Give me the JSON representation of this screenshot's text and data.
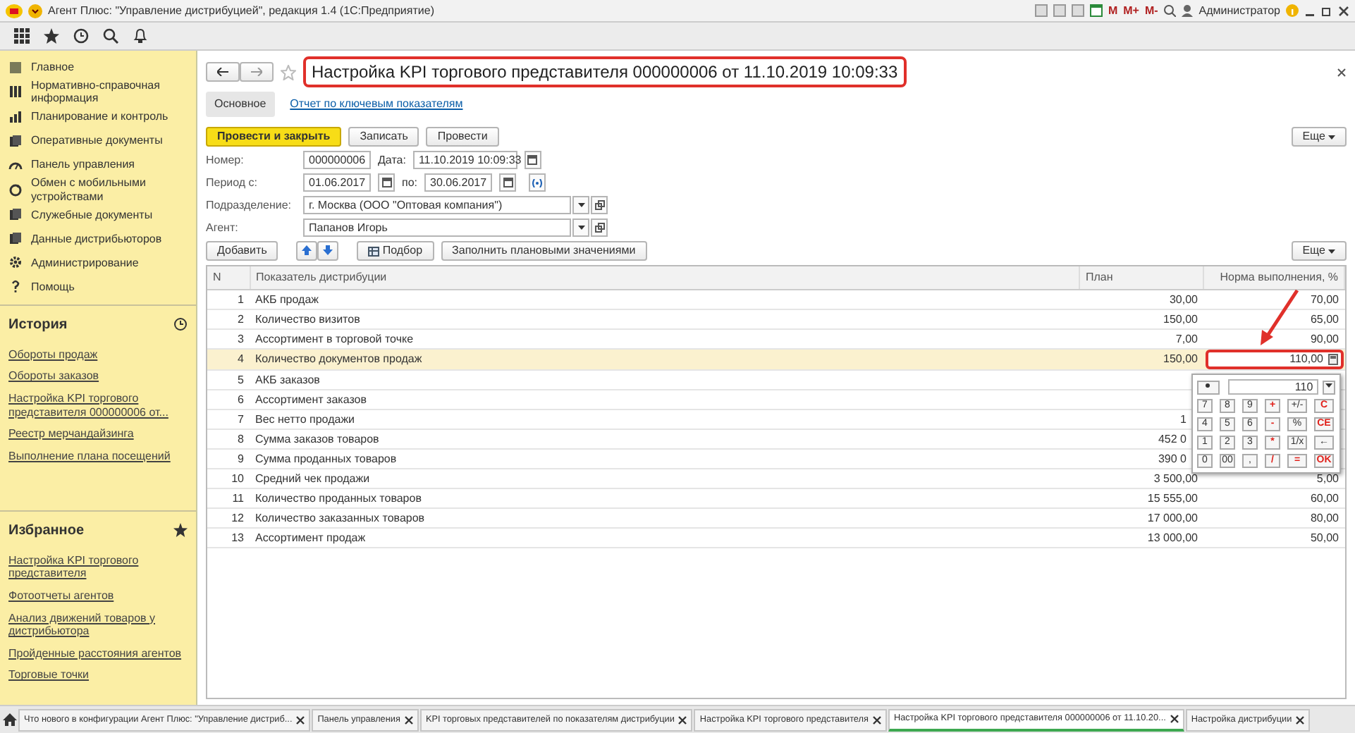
{
  "app_title": "Агент Плюс: \"Управление дистрибуцией\", редакция 1.4  (1С:Предприятие)",
  "top_tools": [
    {
      "label": "M"
    },
    {
      "label": "M+"
    },
    {
      "label": "M-"
    }
  ],
  "user": "Администратор",
  "sidebar": {
    "sections": [
      {
        "label": "Главное"
      },
      {
        "label": "Нормативно-справочная информация"
      },
      {
        "label": "Планирование и контроль"
      },
      {
        "label": "Оперативные документы"
      },
      {
        "label": "Панель управления"
      },
      {
        "label": "Обмен с мобильными устройствами"
      },
      {
        "label": "Служебные документы"
      },
      {
        "label": "Данные дистрибьюторов"
      },
      {
        "label": "Администрирование"
      },
      {
        "label": "Помощь"
      }
    ],
    "history": {
      "title": "История",
      "items": [
        "Обороты продаж",
        "Обороты заказов",
        "Настройка KPI торгового представителя 000000006 от...",
        "Реестр мерчандайзинга",
        "Выполнение плана посещений"
      ]
    },
    "favorites": {
      "title": "Избранное",
      "items": [
        "Настройка KPI торгового представителя",
        "Фотоотчеты агентов",
        "Анализ движений товаров у дистрибьютора",
        "Пройденные расстояния агентов",
        "Торговые точки"
      ]
    }
  },
  "form": {
    "title": "Настройка KPI торгового представителя 000000006 от 11.10.2019 10:09:33",
    "tabs": [
      {
        "label": "Основное",
        "selected": true
      },
      {
        "label": "Отчет по ключевым показателям",
        "selected": false
      }
    ],
    "buttons": [
      {
        "label": "Провести и закрыть",
        "kind": "primary"
      },
      {
        "label": "Записать",
        "kind": "normal"
      },
      {
        "label": "Провести",
        "kind": "normal"
      }
    ],
    "more": "Еще",
    "number": {
      "label": "Номер:",
      "value": "000000006"
    },
    "date": {
      "label": "Дата:",
      "value": "11.10.2019 10:09:33"
    },
    "period_from": {
      "label": "Период с:",
      "value": "01.06.2017"
    },
    "period_to": {
      "label": "по:",
      "value": "30.06.2017"
    },
    "division": {
      "label": "Подразделение:",
      "value": "г. Москва  (ООО \"Оптовая компания\")"
    },
    "agent": {
      "label": "Агент:",
      "value": "Папанов Игорь"
    },
    "table_toolbar": {
      "add": "Добавить",
      "pick": "Подбор",
      "fill": "Заполнить плановыми значениями",
      "more": "Еще"
    },
    "table": {
      "columns": [
        "N",
        "Показатель дистрибуции",
        "План",
        "Норма выполнения, %"
      ],
      "rows": [
        {
          "n": "1",
          "name": "АКБ продаж",
          "plan": "30,00",
          "norm": "70,00",
          "selected": false
        },
        {
          "n": "2",
          "name": "Количество визитов",
          "plan": "150,00",
          "norm": "65,00",
          "selected": false
        },
        {
          "n": "3",
          "name": "Ассортимент в торговой точке",
          "plan": "7,00",
          "norm": "90,00",
          "selected": false
        },
        {
          "n": "4",
          "name": "Количество документов продаж",
          "plan": "150,00",
          "norm": "110,00",
          "selected": true
        },
        {
          "n": "5",
          "name": "АКБ заказов",
          "plan": "",
          "norm": "",
          "selected": false
        },
        {
          "n": "6",
          "name": "Ассортимент заказов",
          "plan": "",
          "norm": "",
          "selected": false
        },
        {
          "n": "7",
          "name": "Вес нетто продажи",
          "plan": "1",
          "norm": "",
          "selected": false
        },
        {
          "n": "8",
          "name": "Сумма заказов товаров",
          "plan": "452 0",
          "norm": "",
          "selected": false
        },
        {
          "n": "9",
          "name": "Сумма проданных товаров",
          "plan": "390 0",
          "norm": "",
          "selected": false
        },
        {
          "n": "10",
          "name": "Средний чек продажи",
          "plan": "3 500,00",
          "norm": "5,00",
          "selected": false
        },
        {
          "n": "11",
          "name": "Количество проданных товаров",
          "plan": "15 555,00",
          "norm": "60,00",
          "selected": false
        },
        {
          "n": "12",
          "name": "Количество заказанных товаров",
          "plan": "17 000,00",
          "norm": "80,00",
          "selected": false
        },
        {
          "n": "13",
          "name": "Ассортимент продаж",
          "plan": "13 000,00",
          "norm": "50,00",
          "selected": false
        }
      ]
    },
    "calculator": {
      "display": "110",
      "keys": [
        [
          {
            "label": "7",
            "kind": "digit"
          },
          {
            "label": "8",
            "kind": "digit"
          },
          {
            "label": "9",
            "kind": "digit"
          },
          {
            "label": "+",
            "kind": "op"
          },
          {
            "label": "+/-",
            "kind": "digit"
          },
          {
            "label": "C",
            "kind": "op"
          }
        ],
        [
          {
            "label": "4",
            "kind": "digit"
          },
          {
            "label": "5",
            "kind": "digit"
          },
          {
            "label": "6",
            "kind": "digit"
          },
          {
            "label": "-",
            "kind": "op"
          },
          {
            "label": "%",
            "kind": "digit"
          },
          {
            "label": "CE",
            "kind": "op"
          }
        ],
        [
          {
            "label": "1",
            "kind": "digit"
          },
          {
            "label": "2",
            "kind": "digit"
          },
          {
            "label": "3",
            "kind": "digit"
          },
          {
            "label": "*",
            "kind": "op"
          },
          {
            "label": "1/x",
            "kind": "digit"
          },
          {
            "label": "←",
            "kind": "digit"
          }
        ],
        [
          {
            "label": "0",
            "kind": "digit"
          },
          {
            "label": "00",
            "kind": "digit"
          },
          {
            "label": ",",
            "kind": "digit"
          },
          {
            "label": "/",
            "kind": "op"
          },
          {
            "label": "=",
            "kind": "op"
          },
          {
            "label": "OK",
            "kind": "op"
          }
        ]
      ]
    }
  },
  "taskbar": [
    {
      "label": "Что нового в конфигурации Агент Плюс: \"Управление дистриб...",
      "selected": false
    },
    {
      "label": "Панель управления",
      "selected": false
    },
    {
      "label": "KPI торговых представителей по показателям дистрибуции",
      "selected": false
    },
    {
      "label": "Настройка KPI торгового представителя",
      "selected": false
    },
    {
      "label": "Настройка KPI торгового представителя 000000006 от 11.10.20...",
      "selected": true
    },
    {
      "label": "Настройка дистрибуции",
      "selected": false
    }
  ]
}
